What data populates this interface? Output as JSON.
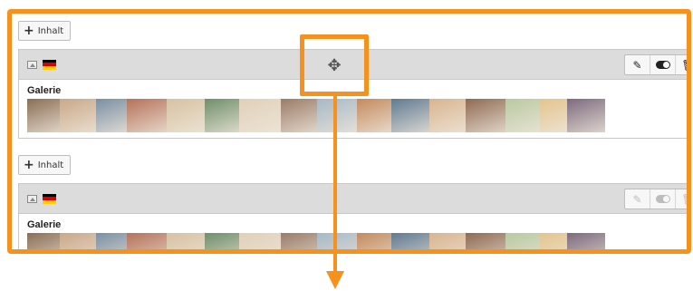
{
  "buttons": {
    "add_content_label": "Inhalt",
    "add_content_icon": "plus-icon"
  },
  "elements": [
    {
      "title": "Galerie",
      "flag": "german-flag-icon",
      "type_icon": "image-content-icon",
      "actions_enabled": true
    },
    {
      "title": "Galerie",
      "flag": "german-flag-icon",
      "type_icon": "image-content-icon",
      "actions_enabled": false
    }
  ],
  "actions": [
    "pencil-icon",
    "toggle-visibility-icon",
    "trash-icon"
  ],
  "annotation": {
    "move_icon": "move-drag-icon",
    "highlight_color": "#f6911e"
  },
  "gallery_colors": [
    "#8a6e55",
    "#c9a888",
    "#7a8fa4",
    "#b5725a",
    "#d7c2a1",
    "#6f8f6a",
    "#e0d0b8",
    "#9a7c68",
    "#a6b8c6",
    "#c48a5e",
    "#5f7a92",
    "#d9b48f",
    "#8f6a52",
    "#b8c9a0",
    "#e3c48d",
    "#7d6a7e"
  ]
}
